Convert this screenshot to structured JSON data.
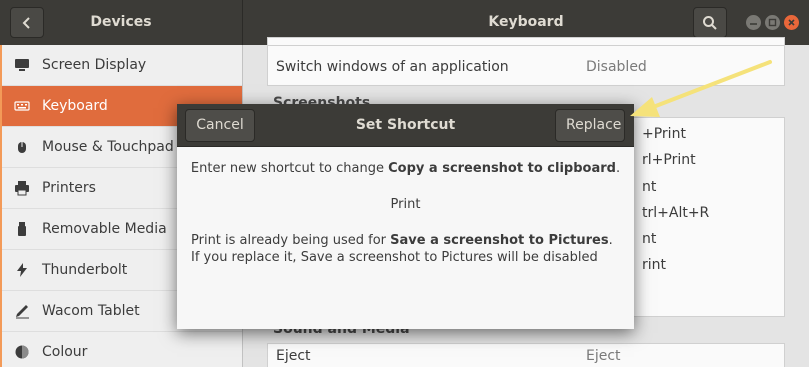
{
  "left_panel_title": "Devices",
  "main_title": "Keyboard",
  "sidebar": {
    "items": [
      {
        "label": "Screen Display",
        "icon": "monitor-icon",
        "selected": false
      },
      {
        "label": "Keyboard",
        "icon": "keyboard-icon",
        "selected": true
      },
      {
        "label": "Mouse & Touchpad",
        "icon": "mouse-icon",
        "selected": false
      },
      {
        "label": "Printers",
        "icon": "printer-icon",
        "selected": false
      },
      {
        "label": "Removable Media",
        "icon": "usb-drive-icon",
        "selected": false
      },
      {
        "label": "Thunderbolt",
        "icon": "thunderbolt-icon",
        "selected": false
      },
      {
        "label": "Wacom Tablet",
        "icon": "tablet-icon",
        "selected": false
      },
      {
        "label": "Colour",
        "icon": "colour-icon",
        "selected": false
      }
    ]
  },
  "shortcuts": {
    "rows_top": [
      {
        "name": "Switch windows of an application",
        "value": "Disabled"
      }
    ],
    "section_screenshots": "Screenshots",
    "background_values": [
      "+Print",
      "rl+Print",
      "nt",
      "trl+Alt+R",
      "nt",
      "rint"
    ],
    "section_sound": "Sound and Media",
    "rows_bottom": [
      {
        "name": "Eject",
        "value": "Eject"
      }
    ]
  },
  "dialog": {
    "title": "Set Shortcut",
    "cancel_label": "Cancel",
    "replace_label": "Replace",
    "line1_prefix": "Enter new shortcut to change ",
    "line1_bold": "Copy a screenshot to clipboard",
    "line1_suffix": ".",
    "new_shortcut": "Print",
    "conflict_prefix": "Print is already being used for ",
    "conflict_bold": "Save a screenshot to Pictures",
    "conflict_suffix": ".",
    "conflict_line2": "If you replace it, Save a screenshot to Pictures will be disabled"
  },
  "colors": {
    "headerbar": "#3c3b37",
    "accent": "#e06c3d",
    "close_button": "#e9673a",
    "arrow": "#f5e27a"
  }
}
